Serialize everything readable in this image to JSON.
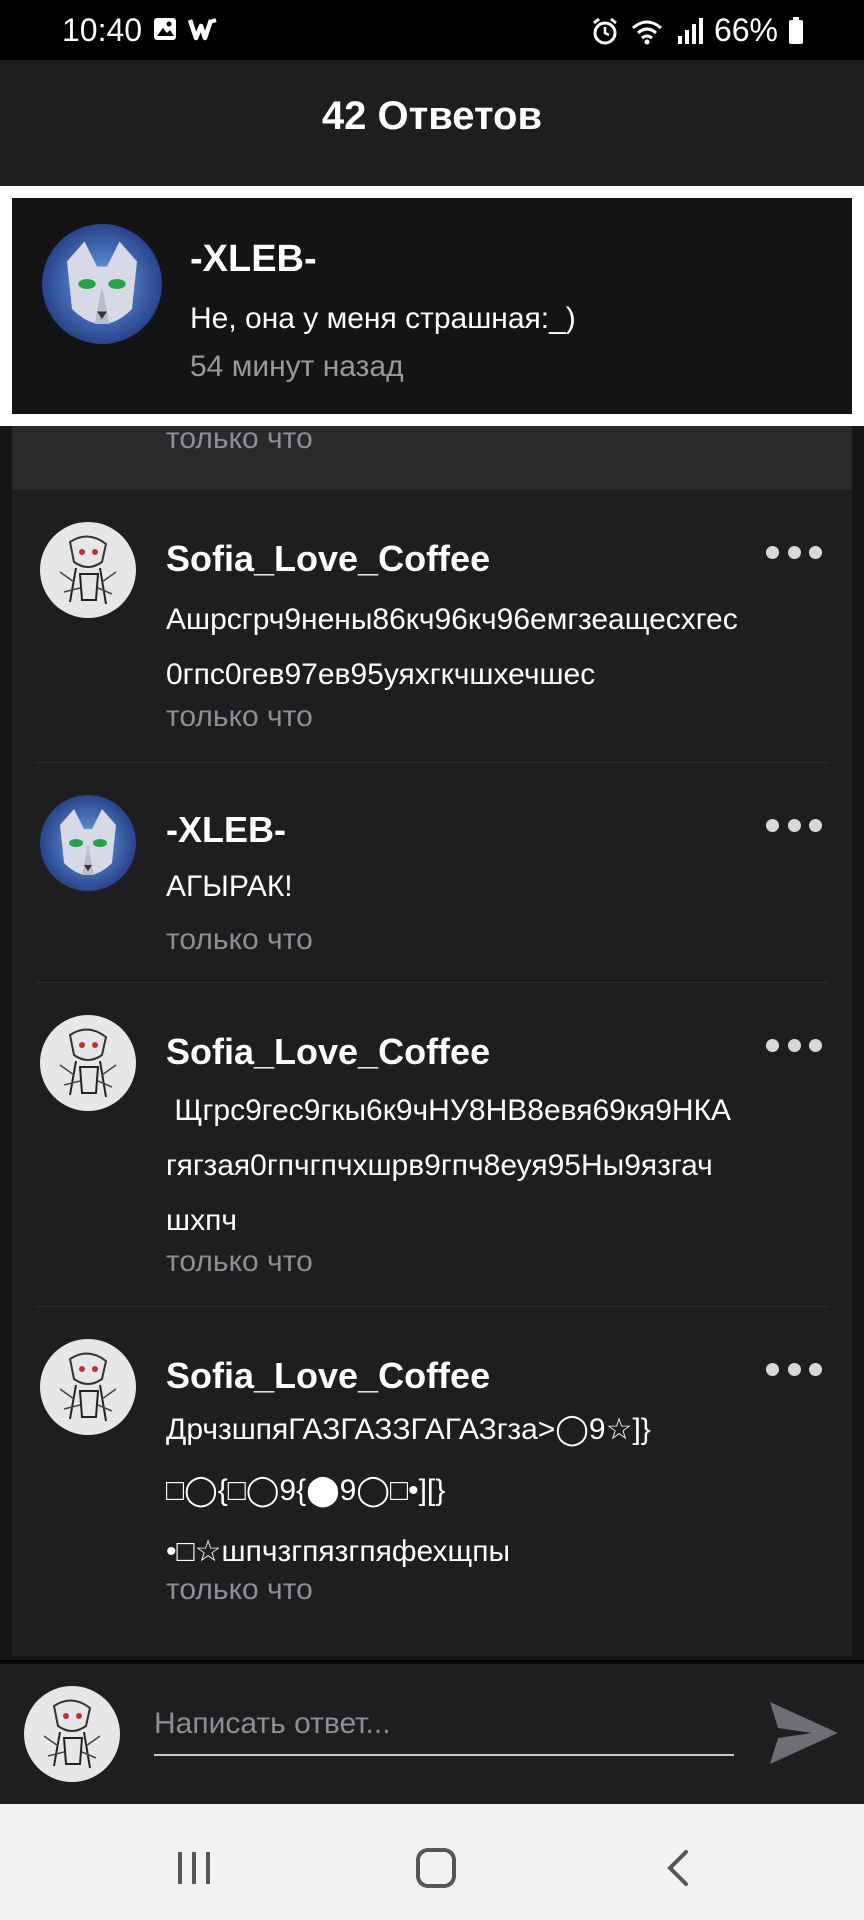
{
  "status_bar": {
    "time": "10:40",
    "battery": "66%",
    "icons": [
      "image-icon",
      "w-icon",
      "alarm-icon",
      "wifi-icon",
      "signal-icon",
      "battery-icon"
    ]
  },
  "header": {
    "title": "42 Ответов"
  },
  "highlight": {
    "author": "-XLEB-",
    "body": "Не, она у меня страшная:_)",
    "time": "54 минут назад"
  },
  "partial": {
    "time": "только что"
  },
  "comments": [
    {
      "author": "Sofia_Love_Coffee",
      "lines": [
        "Ашрсгрч9нены86кч96кч96емгзеащесхгес",
        "0гпс0гев97ев95уяхгкчшхечшес"
      ],
      "time": "только что"
    },
    {
      "author": "-XLEB-",
      "lines": [
        "АГЫРАК!"
      ],
      "time": "только что"
    },
    {
      "author": "Sofia_Love_Coffee",
      "lines": [
        " Щгрс9гес9гкы6к9чНУ8НВ8евя69кя9НКА",
        "гягзая0гпчгпчхшрв9гпч8еуя95Ны9язгач",
        "шхпч"
      ],
      "time": "только что"
    },
    {
      "author": "Sofia_Love_Coffee",
      "lines": [
        "ДрчзшпяГАЗГАЗЗГАГАЗгза>◯9☆]}",
        "□◯{□◯9{⬤9◯□•][}",
        "•□☆шпчзгпязгпяфехщпы"
      ],
      "time": "только что"
    }
  ],
  "reply": {
    "placeholder": "Написать ответ..."
  },
  "colors": {
    "background": "#1e1e21",
    "muted_text": "#8e8e93",
    "nav_bar": "#f2f2f4"
  }
}
